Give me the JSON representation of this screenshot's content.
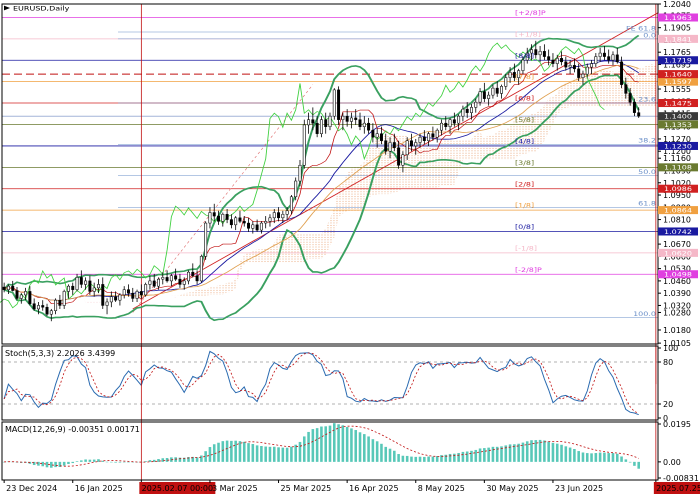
{
  "chart_data": {
    "type": "candlestick",
    "title": "EURUSD,Daily",
    "x_ticks": [
      {
        "label": "23 Dec 2024",
        "idx": 0
      },
      {
        "label": "16 Jan 2025",
        "idx": 16
      },
      {
        "label": "2025.02.07 00:00",
        "idx": 32,
        "highlight": true
      },
      {
        "label": "3 Mar 2025",
        "idx": 48
      },
      {
        "label": "25 Mar 2025",
        "idx": 64
      },
      {
        "label": "16 Apr 2025",
        "idx": 80
      },
      {
        "label": "8 May 2025",
        "idx": 96
      },
      {
        "label": "30 May 2025",
        "idx": 112
      },
      {
        "label": "23 Jun 2025",
        "idx": 128
      },
      {
        "label": "2025.07.25 00:00",
        "idx": 152,
        "highlight": true
      }
    ],
    "price": {
      "ylim": [
        1.01,
        1.204
      ],
      "ticks": [
        "1.2040",
        "1.1975",
        "1.1905",
        "1.1835",
        "1.1765",
        "1.1695",
        "1.1625",
        "1.1555",
        "1.1485",
        "1.1415",
        "1.1340",
        "1.1270",
        "1.1200",
        "1.1160",
        "1.1090",
        "1.1020",
        "1.0950",
        "1.0880",
        "1.0810",
        "1.0740",
        "1.0670",
        "1.0600",
        "1.0530",
        "1.0460",
        "1.0390",
        "1.0320",
        "1.0280",
        "1.0180",
        "1.0105"
      ],
      "tick_values": [
        1.204,
        1.1975,
        1.1905,
        1.1835,
        1.1765,
        1.1695,
        1.1625,
        1.1555,
        1.1485,
        1.1415,
        1.134,
        1.127,
        1.12,
        1.116,
        1.109,
        1.102,
        1.095,
        1.088,
        1.081,
        1.074,
        1.067,
        1.06,
        1.053,
        1.046,
        1.039,
        1.032,
        1.028,
        1.018,
        1.0105
      ]
    },
    "murrey_levels": [
      {
        "label": "[+2/8]P",
        "price": 1.1963,
        "color": "#e040e0",
        "box": "1.1963"
      },
      {
        "label": "[+1/8]",
        "price": 1.1841,
        "color": "#f5b8c8",
        "box": "1.1841"
      },
      {
        "label": "[8/8]",
        "price": 1.1719,
        "color": "#1a1aa0",
        "box": "1.1719"
      },
      {
        "label": "[7/8]",
        "price": 1.1597,
        "color": "#f0a040",
        "box": "1.1597"
      },
      {
        "label": "[6/8]",
        "price": 1.1475,
        "color": "#d02020",
        "box": "1.1475"
      },
      {
        "label": "[5/8]",
        "price": 1.1353,
        "color": "#6a7a30",
        "box": "1.1353"
      },
      {
        "label": "[4/8]",
        "price": 1.123,
        "color": "#1a1aa0",
        "box": "1.1230"
      },
      {
        "label": "[3/8]",
        "price": 1.1108,
        "color": "#6a7a30",
        "box": "1.1108"
      },
      {
        "label": "[2/8]",
        "price": 1.0986,
        "color": "#d02020",
        "box": "1.0986"
      },
      {
        "label": "[1/8]",
        "price": 1.0864,
        "color": "#f0a040",
        "box": "1.0864"
      },
      {
        "label": "[0/8]",
        "price": 1.0742,
        "color": "#1a1aa0",
        "box": "1.0742"
      },
      {
        "label": "[-1/8]",
        "price": 1.062,
        "color": "#f5b8c8",
        "box": "1.0620"
      },
      {
        "label": "[-2/8]P",
        "price": 1.0498,
        "color": "#e040e0",
        "box": "1.0498"
      }
    ],
    "extra_boxes": [
      {
        "price": 1.164,
        "color": "#d02020",
        "label": "1.1640"
      },
      {
        "price": 1.14,
        "color": "#3a3a3a",
        "label": "1.1400"
      }
    ],
    "fibo_levels": [
      {
        "label": "FE 61.8",
        "price": 1.188
      },
      {
        "label": "0.0",
        "price": 1.1841
      },
      {
        "label": "23.6",
        "price": 1.1475
      },
      {
        "label": "38.2",
        "price": 1.124
      },
      {
        "label": "50.0",
        "price": 1.106
      },
      {
        "label": "61.8",
        "price": 1.088
      },
      {
        "label": "100.0",
        "price": 1.025
      }
    ],
    "candles": [
      [
        1.0425,
        1.045,
        1.0395,
        1.041
      ],
      [
        1.041,
        1.044,
        1.0385,
        1.043
      ],
      [
        1.043,
        1.046,
        1.04,
        1.0405
      ],
      [
        1.0405,
        1.0425,
        1.035,
        1.036
      ],
      [
        1.036,
        1.039,
        1.033,
        1.038
      ],
      [
        1.038,
        1.042,
        1.035,
        1.04
      ],
      [
        1.04,
        1.043,
        1.032,
        1.033
      ],
      [
        1.033,
        1.036,
        1.029,
        1.03
      ],
      [
        1.03,
        1.034,
        1.027,
        1.032
      ],
      [
        1.032,
        1.035,
        1.029,
        1.031
      ],
      [
        1.031,
        1.033,
        1.026,
        1.027
      ],
      [
        1.027,
        1.03,
        1.023,
        1.029
      ],
      [
        1.029,
        1.036,
        1.027,
        1.035
      ],
      [
        1.035,
        1.038,
        1.03,
        1.032
      ],
      [
        1.032,
        1.041,
        1.03,
        1.04
      ],
      [
        1.04,
        1.044,
        1.036,
        1.043
      ],
      [
        1.043,
        1.045,
        1.038,
        1.041
      ],
      [
        1.041,
        1.05,
        1.04,
        1.048
      ],
      [
        1.048,
        1.052,
        1.042,
        1.044
      ],
      [
        1.044,
        1.048,
        1.041,
        1.046
      ],
      [
        1.046,
        1.049,
        1.038,
        1.04
      ],
      [
        1.04,
        1.045,
        1.037,
        1.042
      ],
      [
        1.042,
        1.047,
        1.039,
        1.044
      ],
      [
        1.044,
        1.048,
        1.03,
        1.032
      ],
      [
        1.032,
        1.036,
        1.027,
        1.034
      ],
      [
        1.034,
        1.04,
        1.031,
        1.037
      ],
      [
        1.037,
        1.04,
        1.034,
        1.035
      ],
      [
        1.035,
        1.039,
        1.032,
        1.038
      ],
      [
        1.038,
        1.043,
        1.036,
        1.041
      ],
      [
        1.041,
        1.044,
        1.037,
        1.039
      ],
      [
        1.039,
        1.042,
        1.034,
        1.036
      ],
      [
        1.036,
        1.041,
        1.034,
        1.04
      ],
      [
        1.04,
        1.044,
        1.036,
        1.038
      ],
      [
        1.038,
        1.045,
        1.037,
        1.044
      ],
      [
        1.044,
        1.049,
        1.041,
        1.046
      ],
      [
        1.046,
        1.05,
        1.042,
        1.043
      ],
      [
        1.043,
        1.048,
        1.041,
        1.047
      ],
      [
        1.047,
        1.051,
        1.044,
        1.048
      ],
      [
        1.048,
        1.052,
        1.045,
        1.046
      ],
      [
        1.046,
        1.05,
        1.043,
        1.049
      ],
      [
        1.049,
        1.053,
        1.046,
        1.047
      ],
      [
        1.047,
        1.05,
        1.042,
        1.044
      ],
      [
        1.044,
        1.048,
        1.041,
        1.046
      ],
      [
        1.046,
        1.052,
        1.044,
        1.051
      ],
      [
        1.051,
        1.056,
        1.048,
        1.049
      ],
      [
        1.049,
        1.052,
        1.044,
        1.046
      ],
      [
        1.046,
        1.061,
        1.045,
        1.06
      ],
      [
        1.06,
        1.08,
        1.058,
        1.079
      ],
      [
        1.079,
        1.088,
        1.076,
        1.085
      ],
      [
        1.085,
        1.09,
        1.08,
        1.083
      ],
      [
        1.083,
        1.086,
        1.078,
        1.08
      ],
      [
        1.08,
        1.085,
        1.077,
        1.084
      ],
      [
        1.084,
        1.087,
        1.079,
        1.081
      ],
      [
        1.081,
        1.084,
        1.076,
        1.078
      ],
      [
        1.078,
        1.083,
        1.075,
        1.082
      ],
      [
        1.082,
        1.086,
        1.079,
        1.08
      ],
      [
        1.08,
        1.083,
        1.077,
        1.079
      ],
      [
        1.079,
        1.082,
        1.074,
        1.076
      ],
      [
        1.076,
        1.08,
        1.073,
        1.078
      ],
      [
        1.078,
        1.081,
        1.074,
        1.075
      ],
      [
        1.075,
        1.08,
        1.073,
        1.079
      ],
      [
        1.079,
        1.083,
        1.076,
        1.08
      ],
      [
        1.08,
        1.084,
        1.077,
        1.082
      ],
      [
        1.082,
        1.087,
        1.079,
        1.085
      ],
      [
        1.085,
        1.088,
        1.08,
        1.082
      ],
      [
        1.082,
        1.086,
        1.079,
        1.084
      ],
      [
        1.084,
        1.088,
        1.081,
        1.086
      ],
      [
        1.086,
        1.095,
        1.084,
        1.094
      ],
      [
        1.094,
        1.105,
        1.092,
        1.103
      ],
      [
        1.103,
        1.115,
        1.1,
        1.112
      ],
      [
        1.112,
        1.138,
        1.11,
        1.135
      ],
      [
        1.135,
        1.142,
        1.13,
        1.138
      ],
      [
        1.138,
        1.145,
        1.132,
        1.136
      ],
      [
        1.136,
        1.14,
        1.128,
        1.13
      ],
      [
        1.13,
        1.14,
        1.128,
        1.138
      ],
      [
        1.138,
        1.142,
        1.13,
        1.134
      ],
      [
        1.134,
        1.142,
        1.132,
        1.14
      ],
      [
        1.14,
        1.156,
        1.138,
        1.155
      ],
      [
        1.155,
        1.157,
        1.135,
        1.138
      ],
      [
        1.138,
        1.142,
        1.132,
        1.14
      ],
      [
        1.14,
        1.144,
        1.134,
        1.137
      ],
      [
        1.137,
        1.142,
        1.133,
        1.139
      ],
      [
        1.139,
        1.144,
        1.135,
        1.138
      ],
      [
        1.138,
        1.142,
        1.132,
        1.134
      ],
      [
        1.134,
        1.14,
        1.13,
        1.136
      ],
      [
        1.136,
        1.139,
        1.13,
        1.132
      ],
      [
        1.132,
        1.136,
        1.125,
        1.128
      ],
      [
        1.128,
        1.133,
        1.122,
        1.13
      ],
      [
        1.13,
        1.134,
        1.124,
        1.126
      ],
      [
        1.126,
        1.13,
        1.118,
        1.12
      ],
      [
        1.12,
        1.128,
        1.116,
        1.125
      ],
      [
        1.125,
        1.13,
        1.12,
        1.122
      ],
      [
        1.122,
        1.126,
        1.11,
        1.112
      ],
      [
        1.112,
        1.12,
        1.108,
        1.118
      ],
      [
        1.118,
        1.128,
        1.115,
        1.126
      ],
      [
        1.126,
        1.13,
        1.12,
        1.123
      ],
      [
        1.123,
        1.127,
        1.118,
        1.125
      ],
      [
        1.125,
        1.13,
        1.122,
        1.128
      ],
      [
        1.128,
        1.132,
        1.124,
        1.126
      ],
      [
        1.126,
        1.131,
        1.123,
        1.13
      ],
      [
        1.13,
        1.134,
        1.126,
        1.128
      ],
      [
        1.128,
        1.133,
        1.125,
        1.132
      ],
      [
        1.132,
        1.138,
        1.129,
        1.136
      ],
      [
        1.136,
        1.14,
        1.132,
        1.134
      ],
      [
        1.134,
        1.139,
        1.13,
        1.138
      ],
      [
        1.138,
        1.142,
        1.134,
        1.136
      ],
      [
        1.136,
        1.141,
        1.132,
        1.14
      ],
      [
        1.14,
        1.146,
        1.137,
        1.144
      ],
      [
        1.144,
        1.148,
        1.139,
        1.142
      ],
      [
        1.142,
        1.147,
        1.138,
        1.145
      ],
      [
        1.145,
        1.15,
        1.142,
        1.148
      ],
      [
        1.148,
        1.156,
        1.146,
        1.154
      ],
      [
        1.154,
        1.159,
        1.148,
        1.15
      ],
      [
        1.15,
        1.154,
        1.146,
        1.152
      ],
      [
        1.152,
        1.158,
        1.15,
        1.156
      ],
      [
        1.156,
        1.16,
        1.151,
        1.153
      ],
      [
        1.153,
        1.158,
        1.15,
        1.157
      ],
      [
        1.157,
        1.164,
        1.155,
        1.162
      ],
      [
        1.162,
        1.168,
        1.159,
        1.165
      ],
      [
        1.165,
        1.17,
        1.16,
        1.162
      ],
      [
        1.162,
        1.167,
        1.158,
        1.166
      ],
      [
        1.166,
        1.174,
        1.164,
        1.172
      ],
      [
        1.172,
        1.179,
        1.17,
        1.176
      ],
      [
        1.176,
        1.181,
        1.172,
        1.178
      ],
      [
        1.178,
        1.183,
        1.173,
        1.175
      ],
      [
        1.175,
        1.18,
        1.171,
        1.177
      ],
      [
        1.177,
        1.181,
        1.172,
        1.174
      ],
      [
        1.174,
        1.178,
        1.169,
        1.172
      ],
      [
        1.172,
        1.176,
        1.168,
        1.17
      ],
      [
        1.17,
        1.175,
        1.166,
        1.173
      ],
      [
        1.173,
        1.177,
        1.169,
        1.171
      ],
      [
        1.171,
        1.174,
        1.166,
        1.168
      ],
      [
        1.168,
        1.172,
        1.164,
        1.169
      ],
      [
        1.169,
        1.173,
        1.165,
        1.167
      ],
      [
        1.167,
        1.17,
        1.16,
        1.162
      ],
      [
        1.162,
        1.166,
        1.158,
        1.164
      ],
      [
        1.164,
        1.17,
        1.162,
        1.168
      ],
      [
        1.168,
        1.172,
        1.164,
        1.17
      ],
      [
        1.17,
        1.176,
        1.168,
        1.174
      ],
      [
        1.174,
        1.179,
        1.171,
        1.176
      ],
      [
        1.176,
        1.18,
        1.172,
        1.174
      ],
      [
        1.174,
        1.178,
        1.17,
        1.172
      ],
      [
        1.172,
        1.177,
        1.169,
        1.175
      ],
      [
        1.175,
        1.179,
        1.17,
        1.171
      ],
      [
        1.171,
        1.174,
        1.156,
        1.158
      ],
      [
        1.158,
        1.162,
        1.15,
        1.153
      ],
      [
        1.153,
        1.156,
        1.146,
        1.148
      ],
      [
        1.148,
        1.15,
        1.14,
        1.142
      ],
      [
        1.142,
        1.145,
        1.139,
        1.14
      ]
    ],
    "stoch": {
      "title": "Stoch(5,3,3) 2.2026 3.4399",
      "ylim": [
        0,
        100
      ],
      "levels": [
        80,
        20
      ],
      "ticks": [
        "100",
        "80",
        "20",
        "0"
      ]
    },
    "macd": {
      "title": "MACD(12,26,9) -0.00351 0.00171",
      "ticks": [
        "0.0195",
        "0.00",
        "-0.00831"
      ],
      "ylim": [
        -0.00831,
        0.0195
      ]
    }
  }
}
